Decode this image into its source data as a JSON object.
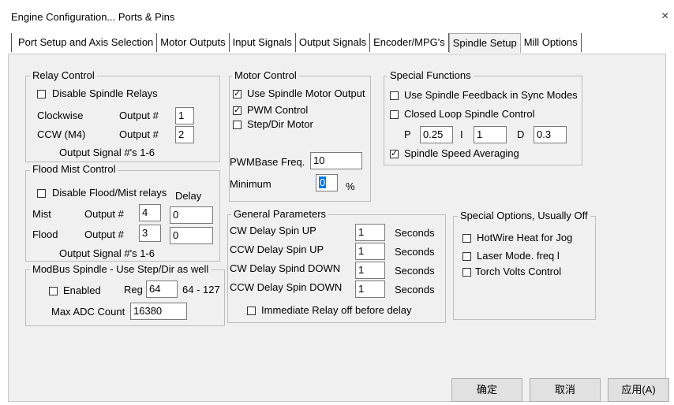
{
  "window": {
    "title": "Engine Configuration... Ports & Pins",
    "close": "×"
  },
  "tabs": [
    {
      "label": "Port Setup and Axis Selection"
    },
    {
      "label": "Motor Outputs"
    },
    {
      "label": "Input Signals"
    },
    {
      "label": "Output Signals"
    },
    {
      "label": "Encoder/MPG's"
    },
    {
      "label": "Spindle Setup"
    },
    {
      "label": "Mill Options"
    }
  ],
  "relay": {
    "title": "Relay Control",
    "disable_label": "Disable Spindle Relays",
    "disable_checked": false,
    "cw_label": "Clockwise",
    "ccw_label": "CCW (M4)",
    "output_label": "Output #",
    "cw_output": "1",
    "ccw_output": "2",
    "range_note": "Output Signal #'s 1-6"
  },
  "flood": {
    "title": "Flood Mist Control",
    "disable_label": "Disable Flood/Mist relays",
    "disable_checked": false,
    "delay_header": "Delay",
    "mist_label": "Mist",
    "flood_label": "Flood",
    "output_label": "Output #",
    "mist_output": "4",
    "mist_delay": "0",
    "flood_output": "3",
    "flood_delay": "0",
    "range_note": "Output Signal #'s 1-6"
  },
  "modbus": {
    "title": "ModBus Spindle - Use Step/Dir as well",
    "enabled_label": "Enabled",
    "enabled_checked": false,
    "reg_label": "Reg",
    "reg_value": "64",
    "reg_range": "64 - 127",
    "max_adc_label": "Max ADC Count",
    "max_adc_value": "16380"
  },
  "motor": {
    "title": "Motor Control",
    "use_output_label": "Use Spindle Motor Output",
    "use_output_checked": true,
    "pwm_label": "PWM Control",
    "pwm_checked": true,
    "stepdir_label": "Step/Dir Motor",
    "stepdir_checked": false,
    "pwmbase_label": "PWMBase Freq.",
    "pwmbase_value": "10",
    "minimum_label": "Minimum",
    "minimum_value": "0",
    "minimum_unit": "%"
  },
  "special": {
    "title": "Special Functions",
    "feedback_label": "Use Spindle Feedback in Sync Modes",
    "feedback_checked": false,
    "closed_loop_label": "Closed Loop Spindle Control",
    "closed_loop_checked": false,
    "p_label": "P",
    "p_value": "0.25",
    "i_label": "I",
    "i_value": "1",
    "d_label": "D",
    "d_value": "0.3",
    "averaging_label": "Spindle Speed Averaging",
    "averaging_checked": true
  },
  "general": {
    "title": "General Parameters",
    "unit": "Seconds",
    "rows": [
      {
        "label": "CW Delay Spin UP",
        "value": "1"
      },
      {
        "label": "CCW Delay Spin UP",
        "value": "1"
      },
      {
        "label": "CW Delay Spind DOWN",
        "value": "1"
      },
      {
        "label": "CCW Delay Spin DOWN",
        "value": "1"
      }
    ],
    "immediate_label": "Immediate Relay off before delay",
    "immediate_checked": false
  },
  "options": {
    "title": "Special Options, Usually Off",
    "hotwire_label": "HotWire Heat for Jog",
    "laser_label": "Laser Mode. freq l",
    "torch_label": "Torch Volts Control"
  },
  "buttons": {
    "ok": "确定",
    "cancel": "取消",
    "apply": "应用(A)"
  }
}
